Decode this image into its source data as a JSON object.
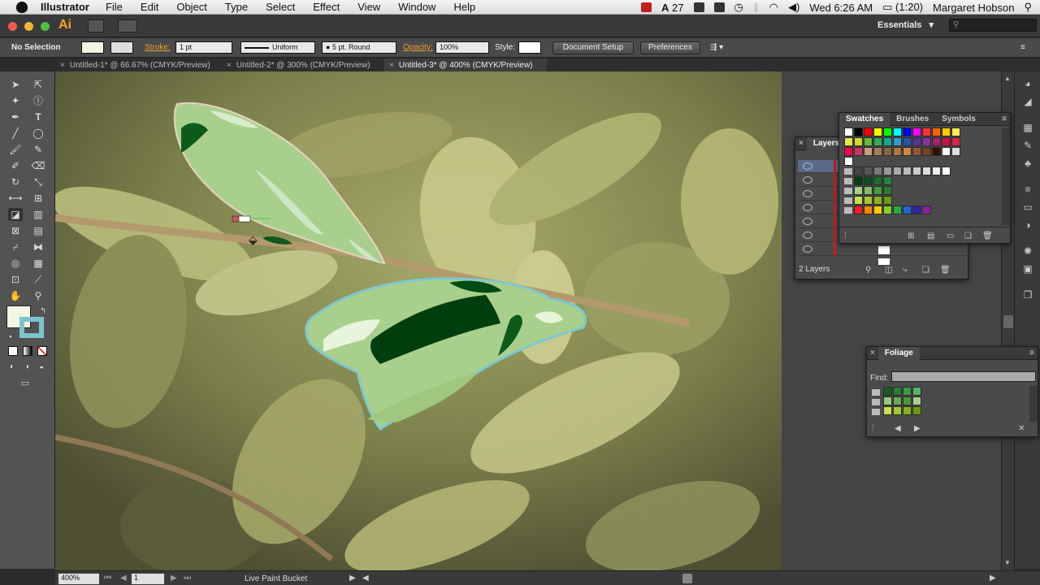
{
  "menubar": {
    "app_name": "Illustrator",
    "items": [
      "File",
      "Edit",
      "Object",
      "Type",
      "Select",
      "Effect",
      "View",
      "Window",
      "Help"
    ],
    "status_number": "27",
    "battery": "(1:20)",
    "clock": "Wed 6:26 AM",
    "user": "Margaret Hobson"
  },
  "appbar": {
    "logo": "Ai",
    "workspace": "Essentials",
    "workspace_arrow": "▾",
    "search_placeholder": ""
  },
  "control_bar": {
    "selection_label": "No Selection",
    "stroke_label": "Stroke:",
    "stroke_weight": "1 pt",
    "profile": "Uniform",
    "brush": "5 pt. Round",
    "opacity_label": "Opacity:",
    "opacity_value": "100%",
    "style_label": "Style:",
    "document_setup": "Document Setup",
    "preferences": "Preferences"
  },
  "tabs": [
    {
      "label": "Untitled-1* @ 66.67% (CMYK/Preview)",
      "active": false
    },
    {
      "label": "Untitled-2* @ 300% (CMYK/Preview)",
      "active": false
    },
    {
      "label": "Untitled-3* @ 400% (CMYK/Preview)",
      "active": true
    }
  ],
  "swatches_panel": {
    "tabs": [
      "Swatches",
      "Brushes",
      "Symbols"
    ],
    "row1": [
      "#ffffff",
      "#000000",
      "#ff0000",
      "#ffff00",
      "#00ff00",
      "#00ffff",
      "#0000ff",
      "#ff00ff",
      "#ff3333",
      "#ff6600",
      "#ffcc00",
      "#ffee55"
    ],
    "row2": [
      "#e8e84a",
      "#c8dd30",
      "#66bb33",
      "#33aa55",
      "#11aa88",
      "#3399cc",
      "#2255aa",
      "#553399",
      "#883399",
      "#aa2266",
      "#cc1144",
      "#dd2244"
    ],
    "row3": [
      "#ff0044",
      "#cc3366",
      "#c8a080",
      "#a08060",
      "#886644",
      "#aa7744",
      "#cc8844",
      "#995533",
      "#774422",
      "#331100",
      "#ffffff",
      "#dddddd"
    ],
    "row4": [
      "#ffffff",
      "#444444",
      "#555555",
      "#777777",
      "#999999",
      "#aaaaaa",
      "#bbbbbb",
      "#cccccc",
      "#dddddd",
      "#eeeeee",
      "#ffffff"
    ],
    "group1": [
      "#0a3d10",
      "#114d22",
      "#1a6b30",
      "#2a8040"
    ],
    "group2": [
      "#a8d08c",
      "#88bb66",
      "#4a9a3a",
      "#2a7a30"
    ],
    "group3": [
      "#c8e050",
      "#a8c830",
      "#88b020",
      "#6a9a10"
    ],
    "group4": [
      "#ee2222",
      "#ff8800",
      "#ffcc00",
      "#88cc22",
      "#22aa44",
      "#2266cc",
      "#3322aa",
      "#882299"
    ]
  },
  "layers_panel": {
    "title": "Layers",
    "footer_label": "2 Layers"
  },
  "foliage_panel": {
    "title": "Foliage",
    "find_label": "Find:",
    "row1": [
      "#1a5a22",
      "#2a7a33",
      "#3a9a44",
      "#5ab066"
    ],
    "row2": [
      "#9ac880",
      "#6aaa55",
      "#4a9a3a",
      "#a8d08c"
    ],
    "row3": [
      "#c8e050",
      "#a8c830",
      "#88b020",
      "#6a9a10"
    ]
  },
  "status_bar": {
    "zoom": "400%",
    "page": "1",
    "current_tool": "Live Paint Bucket"
  }
}
